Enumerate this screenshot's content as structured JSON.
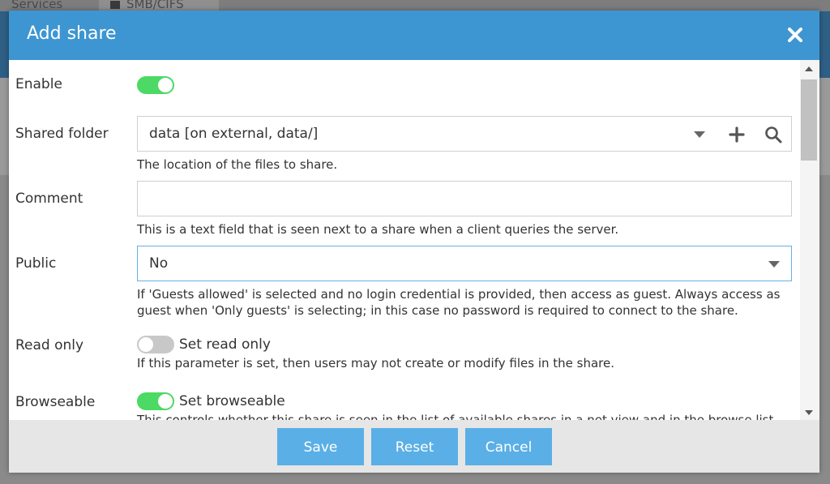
{
  "background": {
    "tabs": [
      {
        "label": "Services"
      },
      {
        "label": "SMB/CIFS"
      }
    ]
  },
  "dialog": {
    "title": "Add share",
    "close_icon": "close-icon"
  },
  "form": {
    "enable": {
      "label": "Enable",
      "state": "on"
    },
    "shared_folder": {
      "label": "Shared folder",
      "value": "data [on external, data/]",
      "hint": "The location of the files to share."
    },
    "comment": {
      "label": "Comment",
      "value": "",
      "hint": "This is a text field that is seen next to a share when a client queries the server."
    },
    "public": {
      "label": "Public",
      "value": "No",
      "hint": "If 'Guests allowed' is selected and no login credential is provided, then access as guest. Always access as guest when 'Only guests' is selecting; in this case no password is required to connect to the share."
    },
    "read_only": {
      "label": "Read only",
      "state": "off",
      "toggle_label": "Set read only",
      "hint": "If this parameter is set, then users may not create or modify files in the share."
    },
    "browseable": {
      "label": "Browseable",
      "state": "on",
      "toggle_label": "Set browseable",
      "hint": "This controls whether this share is seen in the list of available shares in a net view and in the browse list."
    }
  },
  "footer": {
    "save_label": "Save",
    "reset_label": "Reset",
    "cancel_label": "Cancel"
  },
  "colors": {
    "header": "#3d96d2",
    "button": "#5aafe6",
    "toggle_on": "#4cd964",
    "toggle_off": "#c8c8c8"
  }
}
